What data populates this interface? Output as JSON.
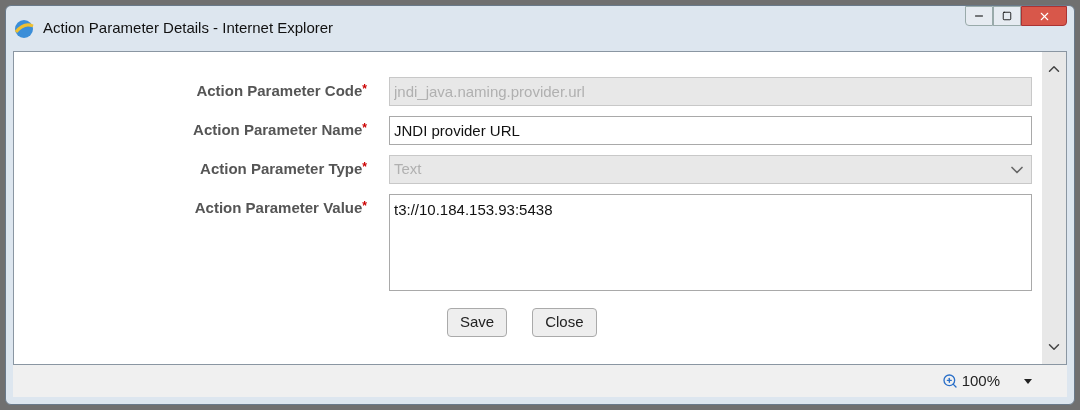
{
  "window": {
    "title": "Action Parameter Details - Internet Explorer"
  },
  "fields": [
    {
      "label": "Action Parameter Code",
      "required_mark": "*",
      "kind": "text",
      "value": "jndi_java.naming.provider.url",
      "disabled": true
    },
    {
      "label": "Action Parameter Name",
      "required_mark": "*",
      "kind": "text",
      "value": "JNDI provider URL",
      "disabled": false
    },
    {
      "label": "Action Parameter Type",
      "required_mark": "*",
      "kind": "select",
      "value": "Text",
      "disabled": true
    },
    {
      "label": "Action Parameter Value",
      "required_mark": "*",
      "kind": "textarea",
      "value": "t3://10.184.153.93:5438",
      "disabled": false
    }
  ],
  "buttons": [
    "Save",
    "Close"
  ],
  "status_bar": {
    "zoom": "100%"
  }
}
